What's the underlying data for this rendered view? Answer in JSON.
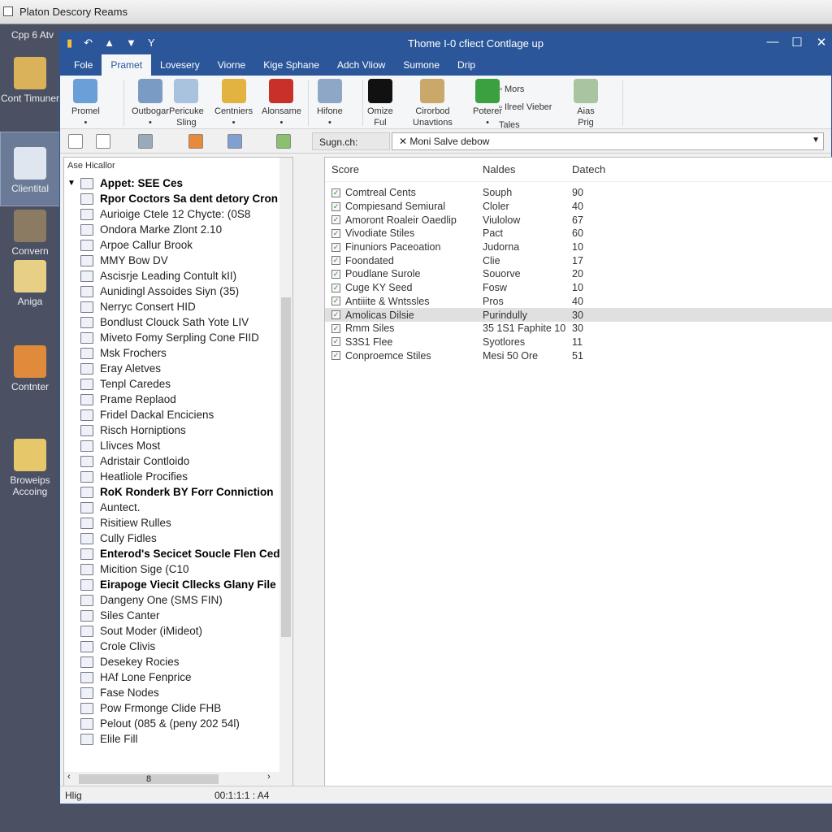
{
  "outer_title": "Platon Descory Reams",
  "desktop": {
    "top_label": "Cpp 6 Atv",
    "icons": [
      {
        "label": "Cont Timuner",
        "color": "#d9b25a"
      },
      {
        "label": "Clientital",
        "color": "#dfe6f0"
      },
      {
        "label": "Convern",
        "color": "#8a7b62"
      },
      {
        "label": "Aniga",
        "color": "#e8cf86"
      },
      {
        "label": "Contnter",
        "color": "#e08a3c"
      },
      {
        "label": "Broweips Accoing",
        "color": "#e6c76a"
      }
    ]
  },
  "window": {
    "title": "Thome I-0 cfiect Contlage up",
    "controls": [
      "—",
      "☐",
      "✕"
    ]
  },
  "tabs": [
    "Fole",
    "Pramet",
    "Lovesery",
    "Viorne",
    "Kige Sphane",
    "Adch Vliow",
    "Sumone",
    "Drip"
  ],
  "active_tab": 1,
  "ribbon": [
    {
      "label": "Promel",
      "sub": "•",
      "color": "#6a9fd8"
    },
    {
      "label": "Outbogar",
      "sub": "•",
      "color": "#7a9cc4"
    },
    {
      "label": "Pericuke",
      "sub": "Sling",
      "color": "#a9c3de"
    },
    {
      "label": "Centniers",
      "sub": "•",
      "color": "#e2b340"
    },
    {
      "label": "Alonsame",
      "sub": "•",
      "color": "#c8302a"
    },
    {
      "label": "Hifone",
      "sub": "•",
      "color": "#8fa7c7"
    },
    {
      "label": "Omize",
      "sub": "Ful",
      "color": "#111111"
    },
    {
      "label": "Cirorbod",
      "sub": "Unavtions",
      "color": "#c9a86a"
    },
    {
      "label": "Poterer",
      "sub": "•",
      "color": "#3aa040"
    },
    {
      "label": "Aias",
      "sub": "Prig",
      "color": "#a8c4a0"
    }
  ],
  "ribbon_small": [
    "Mors",
    "Ilreel Vieber",
    "Tales"
  ],
  "search": {
    "label": "Sugn.ch:",
    "value": "✕ Moni Salve debow"
  },
  "tree": {
    "header": "Ase Hicallor",
    "items": [
      {
        "t": "Appet: SEE Ces",
        "b": true
      },
      {
        "t": "Rpor Coctors Sa dent detory Cron",
        "b": true
      },
      {
        "t": "Aurioige Ctele 12 Chycte: (0S8"
      },
      {
        "t": "Ondora Marke Zlont 2.10"
      },
      {
        "t": "Arpoe Callur Brook"
      },
      {
        "t": "MMY Bow DV"
      },
      {
        "t": "Ascisrje Leading Contult kII)"
      },
      {
        "t": "Aunidingl Assoides Siyn (35)"
      },
      {
        "t": "Nerryc Consert HID"
      },
      {
        "t": "Bondlust Clouck Sath Yote LIV"
      },
      {
        "t": "Miveto Fomy Serpling Cone FIID"
      },
      {
        "t": "Msk Frochers"
      },
      {
        "t": "Eray Aletves"
      },
      {
        "t": "Tenpl Caredes"
      },
      {
        "t": "Prame Replaod"
      },
      {
        "t": "Fridel Dackal Enciciens"
      },
      {
        "t": "Risch Horniptions"
      },
      {
        "t": "Llivces Most"
      },
      {
        "t": "Adristair Contloido"
      },
      {
        "t": "Heatliole Procifies"
      },
      {
        "t": "RoK Ronderk BY Forr Conniction",
        "b": true
      },
      {
        "t": "Auntect."
      },
      {
        "t": "Risitiew Rulles"
      },
      {
        "t": "Cully Fidles"
      },
      {
        "t": "Enterod's Secicet Soucle Flen Cede",
        "b": true
      },
      {
        "t": "Micition Sige (C10"
      },
      {
        "t": "Eirapoge Viecit Cllecks Glany File",
        "b": true
      },
      {
        "t": "Dangeny One (SMS FIN)"
      },
      {
        "t": "Siles Canter"
      },
      {
        "t": "Sout Moder (iMideot)"
      },
      {
        "t": "Crole Clivis"
      },
      {
        "t": "Desekey Rocies"
      },
      {
        "t": "HAf Lone Fenprice"
      },
      {
        "t": "Fase Nodes"
      },
      {
        "t": "Pow Frmonge Clide FHB"
      },
      {
        "t": "Pelout (085 & (peny 202 54l)"
      },
      {
        "t": "Elile Fill"
      }
    ],
    "hscroll_label": "8"
  },
  "list": {
    "columns": [
      "Score",
      "Naldes",
      "Datech"
    ],
    "rows": [
      [
        "Comtreal Cents",
        "Souph",
        "90"
      ],
      [
        "Compiesand Semiural",
        "Cloler",
        "40"
      ],
      [
        "Amoront Roaleir Oaedlip",
        "Viulolow",
        "67"
      ],
      [
        "Vivodiate Stiles",
        "Pact",
        "60"
      ],
      [
        "Finuniors Paceoation",
        "Judorna",
        "10"
      ],
      [
        "Foondated",
        "Clie",
        "17"
      ],
      [
        "Poudlane Surole",
        "Souorve",
        "20"
      ],
      [
        "Cuge KY Seed",
        "Fosw",
        "10"
      ],
      [
        "Antiiite & Wntssles",
        "Pros",
        "40"
      ],
      [
        "Amolicas Dilsie",
        "Purindully",
        "30"
      ],
      [
        "Rmm Siles",
        "35 1S1 Faphite 10",
        "30"
      ],
      [
        "S3S1 Flee",
        "Syotlores",
        "11"
      ],
      [
        "Conproemce Stiles",
        "Mesi 50 Ore",
        "51"
      ]
    ],
    "selected_row": 9
  },
  "status": {
    "left": "Hlig",
    "right": "00:1:1:1 : A4"
  }
}
